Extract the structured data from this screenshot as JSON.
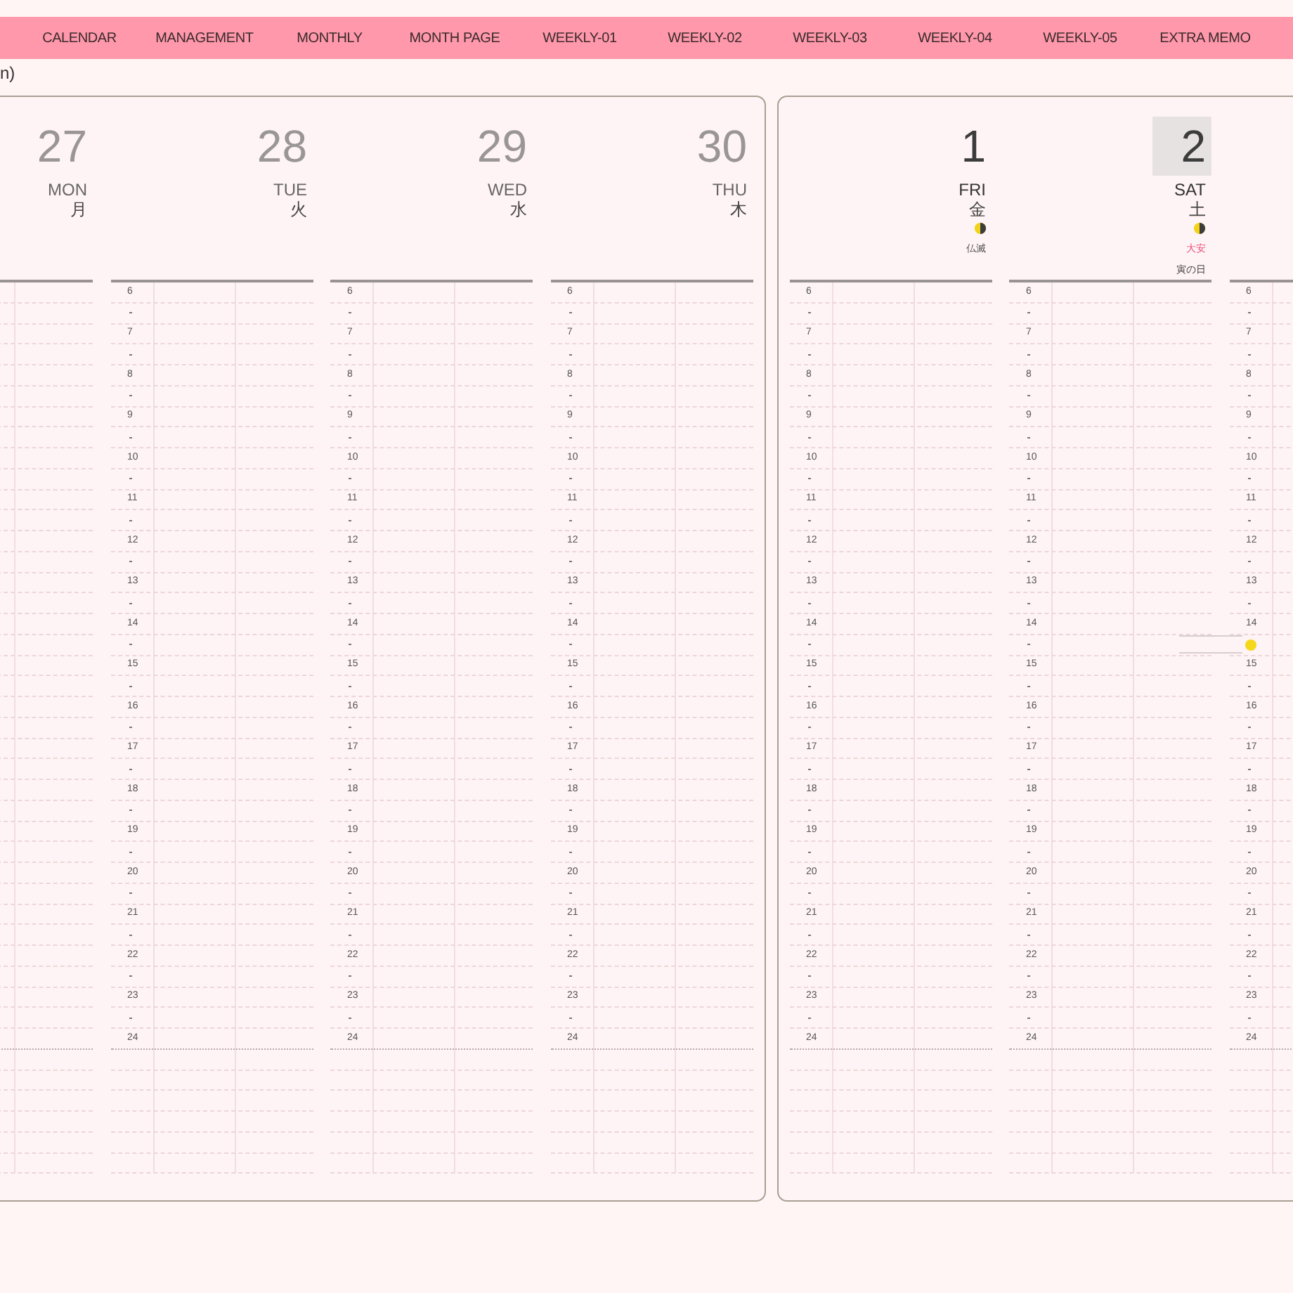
{
  "nav": {
    "tabs": [
      {
        "label": "CALENDAR"
      },
      {
        "label": "MANAGEMENT"
      },
      {
        "label": "MONTHLY"
      },
      {
        "label": "MONTH PAGE"
      },
      {
        "label": "WEEKLY-01"
      },
      {
        "label": "WEEKLY-02"
      },
      {
        "label": "WEEKLY-03"
      },
      {
        "label": "WEEKLY-04"
      },
      {
        "label": "WEEKLY-05"
      },
      {
        "label": "EXTRA MEMO"
      }
    ]
  },
  "breadcrumb": "n)",
  "pages": [
    {
      "days": [
        {
          "number": "27",
          "weekday": "MON",
          "kanji": "月",
          "other_month": true,
          "today": false,
          "moon": false
        },
        {
          "number": "28",
          "weekday": "TUE",
          "kanji": "火",
          "other_month": true,
          "today": false,
          "moon": false,
          "hours": [
            "6",
            "7",
            "8",
            "9",
            "10",
            "11",
            "12",
            "13",
            "14",
            "15",
            "16",
            "17",
            "18",
            "19",
            "20",
            "21",
            "22",
            "23",
            "24"
          ]
        },
        {
          "number": "29",
          "weekday": "WED",
          "kanji": "水",
          "other_month": true,
          "today": false,
          "moon": false,
          "hours": [
            "6",
            "7",
            "8",
            "9",
            "10",
            "11",
            "12",
            "13",
            "14",
            "15",
            "16",
            "17",
            "18",
            "19",
            "20",
            "21",
            "22",
            "23",
            "24"
          ]
        },
        {
          "number": "30",
          "weekday": "THU",
          "kanji": "木",
          "other_month": true,
          "today": false,
          "moon": false,
          "hours": [
            "6",
            "7",
            "8",
            "9",
            "10",
            "11",
            "12",
            "13",
            "14",
            "15",
            "16",
            "17",
            "18",
            "19",
            "20",
            "21",
            "22",
            "23",
            "24"
          ]
        }
      ]
    },
    {
      "days": [
        {
          "number": "1",
          "weekday": "FRI",
          "kanji": "金",
          "other_month": false,
          "today": false,
          "moon": true,
          "rokuyo": {
            "text": "仏滅",
            "color": "#555555"
          },
          "hours": [
            "6",
            "7",
            "8",
            "9",
            "10",
            "11",
            "12",
            "13",
            "14",
            "15",
            "16",
            "17",
            "18",
            "19",
            "20",
            "21",
            "22",
            "23",
            "24"
          ]
        },
        {
          "number": "2",
          "weekday": "SAT",
          "kanji": "土",
          "other_month": false,
          "today": true,
          "moon": true,
          "rokuyo": {
            "text": "大安",
            "color": "#e8507a"
          },
          "note": "寅の日",
          "hours": [
            "6",
            "7",
            "8",
            "9",
            "10",
            "11",
            "12",
            "13",
            "14",
            "15",
            "16",
            "17",
            "18",
            "19",
            "20",
            "21",
            "22",
            "23",
            "24"
          ]
        },
        {
          "moon": false,
          "time_marker": true,
          "hours": [
            "6",
            "7",
            "8",
            "9",
            "10",
            "11",
            "12",
            "13",
            "14",
            "15",
            "16",
            "17",
            "18",
            "19",
            "20",
            "21",
            "22",
            "23",
            "24"
          ]
        }
      ]
    }
  ]
}
